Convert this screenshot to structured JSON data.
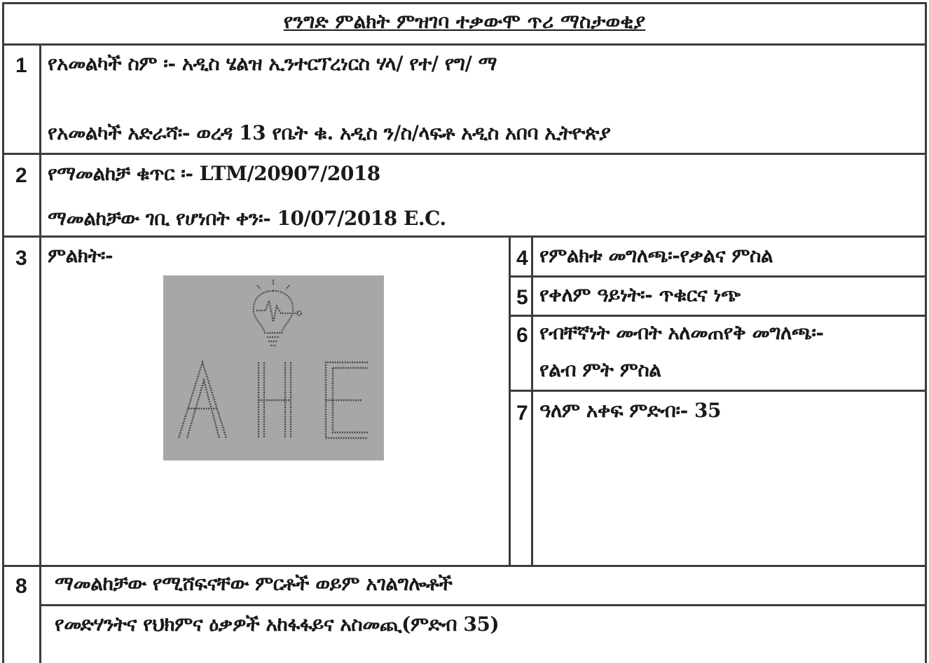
{
  "title": "የንግድ ምልክት ምዝገባ ተቃውሞ ጥሪ ማስታወቂያ",
  "rows": {
    "row1": {
      "number": "1",
      "applicant_name": "የአመልካች ስም ፡- አዲስ ሄልዝ ኢንተርፕረነርስ ሃላ/ የተ/ የግ/ ማ",
      "applicant_address": "የአመልካች አድራሻ፡- ወረዳ 13 የቤት ቁ. አዲስ ን/ስ/ላፍቶ አዲስ አበባ ኢትዮጵያ"
    },
    "row2": {
      "number": "2",
      "application_no": "የማመልከቻ ቁጥር ፡- LTM/20907/2018",
      "filing_date": "ማመልከቻው ገቢ የሆነበት ቀን፡- 10/07/2018 E.C."
    },
    "row3": {
      "number": "3",
      "mark_label": "ምልክት፡-",
      "logo_letters": [
        "A",
        "H",
        "E"
      ]
    },
    "details": [
      {
        "number": "4",
        "text": "የምልክቱ መግለጫ፡-የቃልና ምስል"
      },
      {
        "number": "5",
        "text": "የቀለም ዓይነት፡- ጥቁርና ነጭ"
      },
      {
        "number": "6",
        "text": "የብቸኛነት መብት አለመጠየቅ መግለጫ፡-",
        "text2": "የልብ ምት ምስል"
      },
      {
        "number": "7",
        "text": "ዓለም አቀፍ ምድብ፡- 35"
      }
    ],
    "row8": {
      "number": "8",
      "goods_label": "ማመልከቻው የሚሸፍናቸው ምርቶች ወይም አገልግሎቶች",
      "goods_text": "የመድሃንትና የህክምና ዕቃዎች አከፋፋይና አስመጪ(ምድብ 35)"
    }
  },
  "colors": {
    "border": "#3c3c3c",
    "logo_bg": "#a7a7a9",
    "logo_stroke": "#4a4a4c"
  }
}
